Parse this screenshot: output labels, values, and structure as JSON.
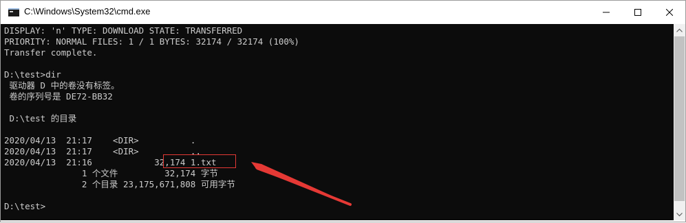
{
  "window": {
    "title": "C:\\Windows\\System32\\cmd.exe",
    "icon": "cmd-icon"
  },
  "console_lines": [
    "DISPLAY: 'n' TYPE: DOWNLOAD STATE: TRANSFERRED",
    "PRIORITY: NORMAL FILES: 1 / 1 BYTES: 32174 / 32174 (100%)",
    "Transfer complete.",
    "",
    "D:\\test>dir",
    " 驱动器 D 中的卷没有标签。",
    " 卷的序列号是 DE72-BB32",
    "",
    " D:\\test 的目录",
    "",
    "2020/04/13  21:17    <DIR>          .",
    "2020/04/13  21:17    <DIR>          ..",
    "2020/04/13  21:16            32,174 1.txt",
    "               1 个文件         32,174 字节",
    "               2 个目录 23,175,671,808 可用字节",
    "",
    "D:\\test>"
  ],
  "annotation": {
    "highlighted_text": "32,174 1.txt",
    "color": "#e53935"
  },
  "colors": {
    "console_bg": "#0c0c0c",
    "console_fg": "#cccccc",
    "titlebar_bg": "#ffffff"
  }
}
